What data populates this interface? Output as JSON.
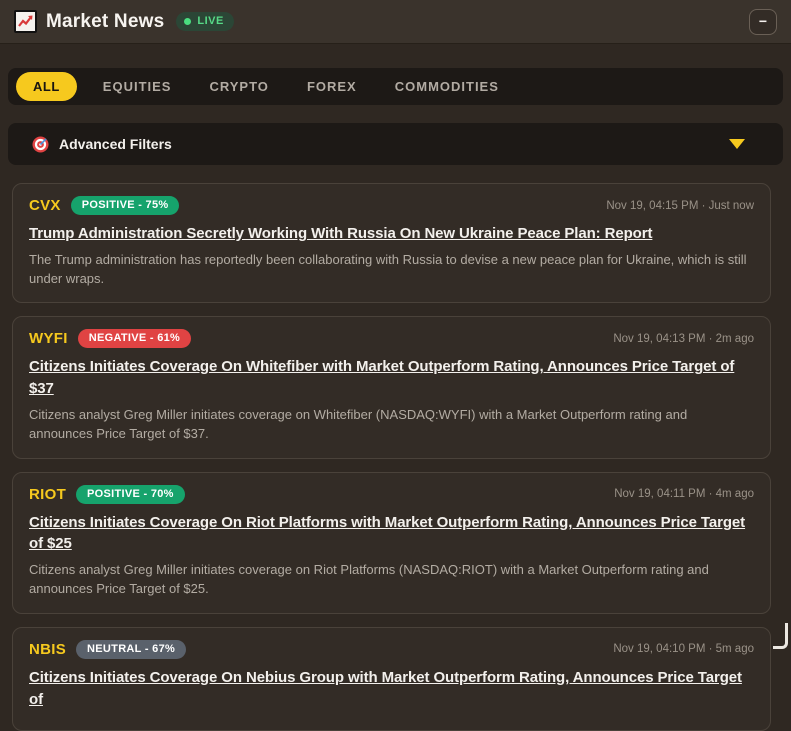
{
  "header": {
    "title": "Market News",
    "live_label": "LIVE",
    "minimize_label": "−"
  },
  "tabs": [
    {
      "label": "ALL",
      "active": true
    },
    {
      "label": "EQUITIES",
      "active": false
    },
    {
      "label": "CRYPTO",
      "active": false
    },
    {
      "label": "FOREX",
      "active": false
    },
    {
      "label": "COMMODITIES",
      "active": false
    }
  ],
  "filters": {
    "label": "Advanced Filters"
  },
  "articles": [
    {
      "ticker": "CVX",
      "sentiment": "POSITIVE - 75%",
      "sentiment_type": "positive",
      "timestamp": "Nov 19, 04:15 PM · Just now",
      "headline": "Trump Administration Secretly Working With Russia On New Ukraine Peace Plan: Report",
      "summary": "The Trump administration has reportedly been collaborating with Russia to devise a new peace plan for Ukraine, which is still under wraps."
    },
    {
      "ticker": "WYFI",
      "sentiment": "NEGATIVE - 61%",
      "sentiment_type": "negative",
      "timestamp": "Nov 19, 04:13 PM · 2m ago",
      "headline": "Citizens Initiates Coverage On Whitefiber with Market Outperform Rating, Announces Price Target of $37",
      "summary": "Citizens analyst Greg Miller initiates coverage on Whitefiber (NASDAQ:WYFI) with a Market Outperform rating and announces Price Target of $37."
    },
    {
      "ticker": "RIOT",
      "sentiment": "POSITIVE - 70%",
      "sentiment_type": "positive",
      "timestamp": "Nov 19, 04:11 PM · 4m ago",
      "headline": "Citizens Initiates Coverage On Riot Platforms with Market Outperform Rating, Announces Price Target of $25",
      "summary": "Citizens analyst Greg Miller initiates coverage on Riot Platforms (NASDAQ:RIOT) with a Market Outperform rating and announces Price Target of $25."
    },
    {
      "ticker": "NBIS",
      "sentiment": "NEUTRAL - 67%",
      "sentiment_type": "neutral",
      "timestamp": "Nov 19, 04:10 PM · 5m ago",
      "headline": "Citizens Initiates Coverage On Nebius Group with Market Outperform Rating, Announces Price Target of",
      "summary": ""
    }
  ],
  "colors": {
    "accent_yellow": "#f6c91e",
    "positive": "#16a36c",
    "negative": "#e04343",
    "neutral": "#5a616b",
    "live_green": "#4ade80"
  }
}
